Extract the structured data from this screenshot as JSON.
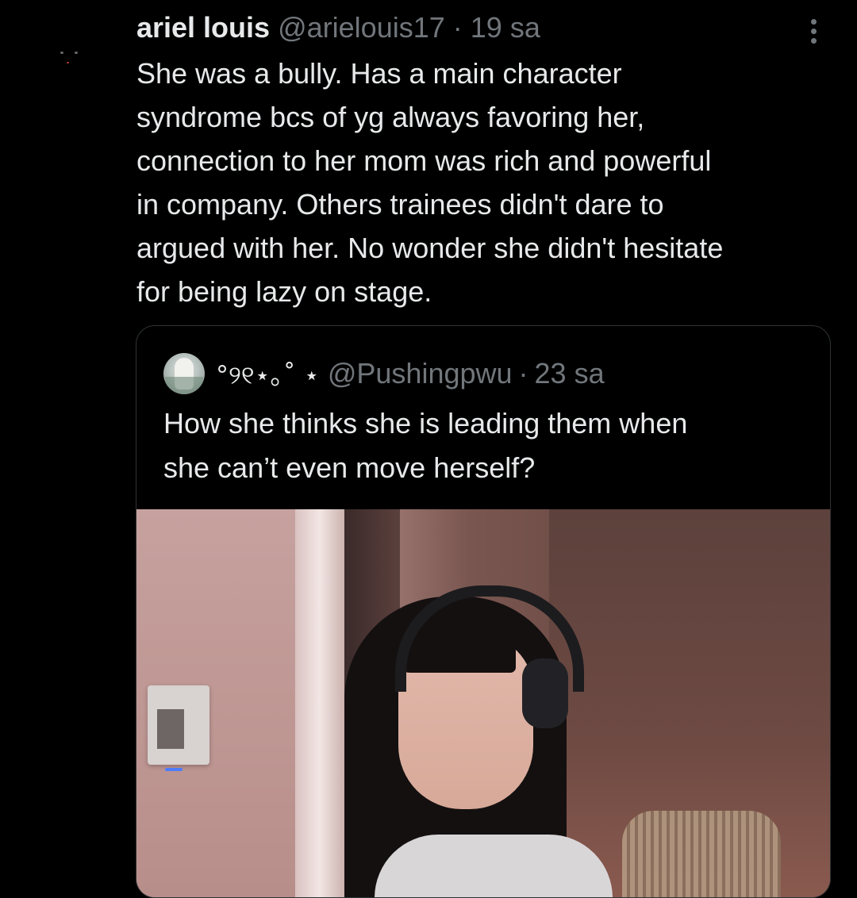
{
  "tweet": {
    "author_name": "ariel louis",
    "handle": "@arielouis17",
    "separator": "·",
    "time": "19 sa",
    "text_lines": [
      "She was a bully. Has a main character",
      "syndrome bcs of yg always favoring her,",
      "connection to her mom was rich and powerful",
      "in company. Others trainees didn't dare to",
      "argued with her. No wonder she didn't hesitate",
      "for being lazy on stage."
    ],
    "more_icon": "more-vertical-icon"
  },
  "quoted_tweet": {
    "author_name": "°୨୧⋆｡˚ ⋆",
    "handle": "@Pushingpwu",
    "separator": "·",
    "time": "23 sa",
    "text_lines": [
      "How she thinks she is leading them when",
      "she can’t even move herself?"
    ]
  },
  "colors": {
    "background": "#000000",
    "primary_text": "#e7e9ea",
    "secondary_text": "#71767b",
    "card_border": "#2f3336"
  }
}
